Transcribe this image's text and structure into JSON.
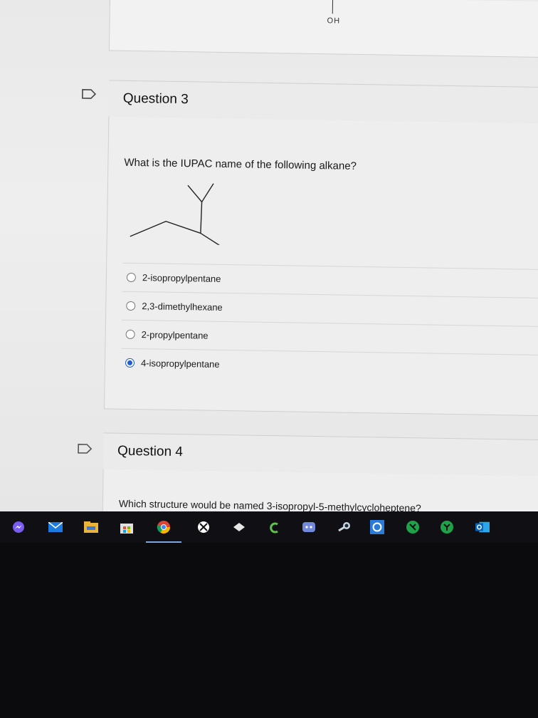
{
  "prev_question": {
    "oh_label": "OH"
  },
  "question3": {
    "title": "Question 3",
    "prompt": "What is the IUPAC name of the following alkane?",
    "answers": [
      {
        "label": "2-isopropylpentane",
        "selected": false
      },
      {
        "label": "2,3-dimethylhexane",
        "selected": false
      },
      {
        "label": "2-propylpentane",
        "selected": false
      },
      {
        "label": "4-isopropylpentane",
        "selected": true
      }
    ]
  },
  "question4": {
    "title": "Question 4",
    "prompt": "Which structure would be named 3-isopropyl-5-methylcycloheptene?"
  },
  "taskbar": {
    "icons": [
      "messenger-icon",
      "mail-icon",
      "file-explorer-icon",
      "store-icon",
      "chrome-icon",
      "xbox-icon",
      "dropbox-icon",
      "cricut-icon",
      "discord-icon",
      "steam-icon",
      "cortana-icon",
      "app-green-icon",
      "app-green-icon-2",
      "outlook-icon"
    ]
  }
}
